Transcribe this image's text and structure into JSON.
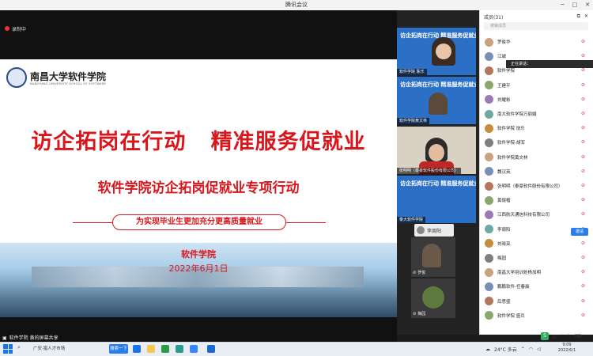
{
  "window": {
    "title": "腾讯会议"
  },
  "recording": {
    "label": "录制中"
  },
  "slide": {
    "logo_text": "南昌大学软件学院",
    "logo_sub": "NANCHANG UNIVERSITY SCHOOL OF SOFTWARE",
    "title": "访企拓岗在行动   精准服务促就业",
    "subtitle": "软件学院访企拓岗促就业专项行动",
    "slogan": "为实现毕业生更加充分更高质量就业",
    "school": "软件学院",
    "date": "2022年6月1日"
  },
  "share_bar": {
    "text": "软件学院 黄的屏幕共享"
  },
  "videos": [
    {
      "title": "访企拓岗在行动  精准服务促就业",
      "label": "软件学院 陈乐"
    },
    {
      "title": "访企拓岗在行动  精准服务促就业",
      "label": "软件学院黄文林"
    },
    {
      "title": "",
      "label": "张明明（泰豪软件股份有限公司）"
    },
    {
      "title": "访企拓岗在行动  精准服务促就业",
      "label": "泰大软件学院"
    }
  ],
  "small_videos": [
    {
      "name": "李周阳"
    },
    {
      "name": "罗俊"
    },
    {
      "name": "梅园"
    }
  ],
  "members": {
    "header": "成员(31)",
    "search_placeholder": "搜索成员",
    "tooltip": "正在讲话：",
    "invite_label": "邀请",
    "list": [
      {
        "name": "罗俊华"
      },
      {
        "name": "江城"
      },
      {
        "name": "软件学院"
      },
      {
        "name": "王建平"
      },
      {
        "name": "刘耀彬"
      },
      {
        "name": "南大软件学院万丽娟"
      },
      {
        "name": "软件学院 饶乐"
      },
      {
        "name": "软件学院-胡军"
      },
      {
        "name": "软件学院黄文林"
      },
      {
        "name": "魏汉英"
      },
      {
        "name": "张明明（泰豪软件股份有限公司）"
      },
      {
        "name": "黄琨楷"
      },
      {
        "name": "江西航天通信科技有限公司"
      },
      {
        "name": "李周阳"
      },
      {
        "name": "刘晓亮"
      },
      {
        "name": "梅园"
      },
      {
        "name": "南昌大学培训处杨加明"
      },
      {
        "name": "鹏鹏软件-任春晨"
      },
      {
        "name": "后思盛"
      },
      {
        "name": "软件学院 盛兵"
      }
    ]
  },
  "taskbar": {
    "app_label": "广安·猎人才市场",
    "active_button": "搜索一下",
    "weather": "24°C 多云",
    "time": "9:09",
    "date": "2022/6/1",
    "ime": "五"
  },
  "colors": {
    "accent": "#d9161c",
    "brand_blue": "#2b7de9"
  }
}
